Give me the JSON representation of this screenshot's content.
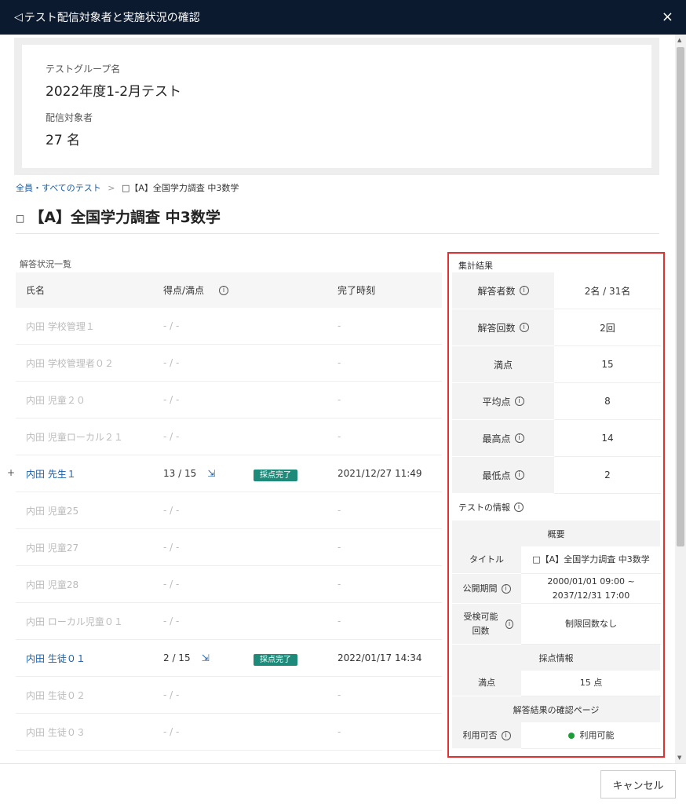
{
  "header": {
    "title": "テスト配信対象者と実施状況の確認",
    "close": "×",
    "icon": "◁"
  },
  "summary": {
    "group_label": "テストグループ名",
    "group_value": "2022年度1-2月テスト",
    "target_label": "配信対象者",
    "target_value": "27 名"
  },
  "breadcrumb": {
    "root": "全員・すべてのテスト",
    "sep": ">",
    "current": "□【A】全国学力調査 中3数学"
  },
  "page_title": {
    "icon": "□",
    "text": "【A】全国学力調査 中3数学"
  },
  "list": {
    "label": "解答状況一覧",
    "headers": {
      "name": "氏名",
      "score": "得点/満点",
      "completed": "完了時刻"
    },
    "rows": [
      {
        "name": "内田 学校管理１",
        "score": "- / -",
        "status": "",
        "time": "-"
      },
      {
        "name": "内田 学校管理者０２",
        "score": "- / -",
        "status": "",
        "time": "-"
      },
      {
        "name": "内田 児童２０",
        "score": "- / -",
        "status": "",
        "time": "-"
      },
      {
        "name": "内田 児童ローカル２１",
        "score": "- / -",
        "status": "",
        "time": "-"
      },
      {
        "name": "内田 先生１",
        "score": "13 / 15",
        "status": "採点完了",
        "time": "2021/12/27 11:49"
      },
      {
        "name": "内田 児童25",
        "score": "- / -",
        "status": "",
        "time": "-"
      },
      {
        "name": "内田 児童27",
        "score": "- / -",
        "status": "",
        "time": "-"
      },
      {
        "name": "内田 児童28",
        "score": "- / -",
        "status": "",
        "time": "-"
      },
      {
        "name": "内田 ローカル児童０１",
        "score": "- / -",
        "status": "",
        "time": "-"
      },
      {
        "name": "内田 生徒０１",
        "score": "2 / 15",
        "status": "採点完了",
        "time": "2022/01/17 14:34"
      },
      {
        "name": "内田 生徒０２",
        "score": "- / -",
        "status": "",
        "time": "-"
      },
      {
        "name": "内田 生徒０３",
        "score": "- / -",
        "status": "",
        "time": "-"
      }
    ]
  },
  "aggregate": {
    "title": "集計結果",
    "rows": [
      {
        "label": "解答者数",
        "value": "2名 / 31名"
      },
      {
        "label": "解答回数",
        "value": "2回"
      },
      {
        "label": "満点",
        "value": "15"
      },
      {
        "label": "平均点",
        "value": "8"
      },
      {
        "label": "最高点",
        "value": "14"
      },
      {
        "label": "最低点",
        "value": "2"
      }
    ]
  },
  "test_info": {
    "title": "テストの情報",
    "overview": "概要",
    "title_label": "タイトル",
    "title_value": "□【A】全国学力調査 中3数学",
    "period_label": "公開期間",
    "period_value": "2000/01/01 09:00 ~ 2037/12/31 17:00",
    "attempts_label": "受検可能回数",
    "attempts_value": "制限回数なし",
    "grading": "採点情報",
    "full_label": "満点",
    "full_value": "15 点",
    "result_page": "解答結果の確認ページ",
    "avail_label": "利用可否",
    "avail_value": "利用可能"
  },
  "footer": {
    "cancel": "キャンセル"
  },
  "colors": {
    "header_bg": "#0b1a2e",
    "badge": "#1e8a7a",
    "link": "#1a5fa8",
    "highlight": "#e03030",
    "available": "#1b9e3a"
  }
}
